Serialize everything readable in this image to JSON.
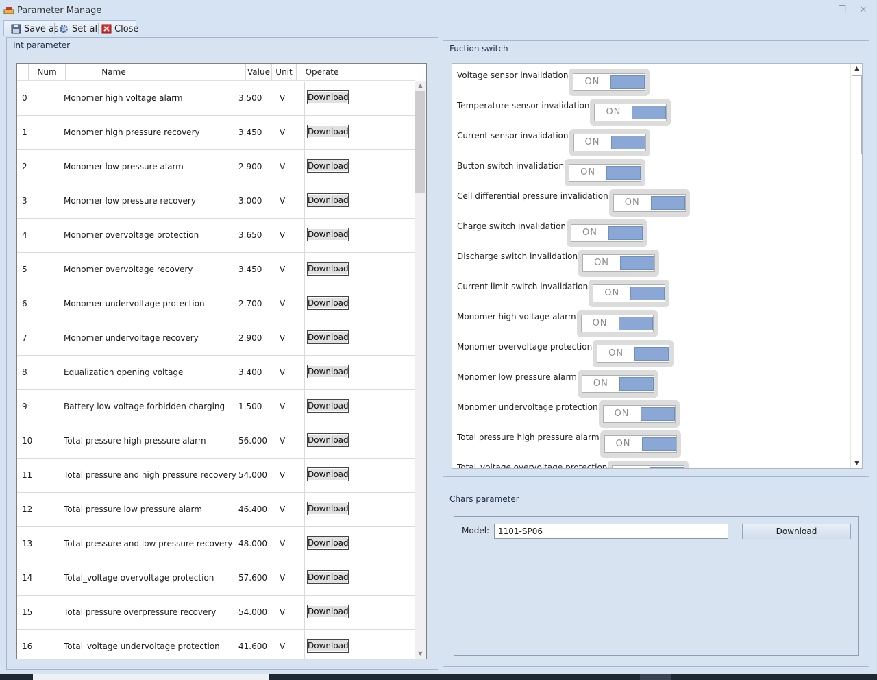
{
  "window": {
    "title": "Parameter Manage"
  },
  "toolbar": {
    "save_as": "Save as",
    "set_all": "Set all",
    "close": "Close"
  },
  "int_panel": {
    "title": "Int parameter",
    "headers": {
      "num": "Num",
      "name": "Name",
      "value": "Value",
      "unit": "Unit",
      "operate": "Operate"
    },
    "rows": [
      {
        "num": "0",
        "name": "Monomer high voltage alarm",
        "value": "3.500",
        "unit": "V",
        "action": "Download"
      },
      {
        "num": "1",
        "name": "Monomer high pressure recovery",
        "value": "3.450",
        "unit": "V",
        "action": "Download"
      },
      {
        "num": "2",
        "name": "Monomer low pressure alarm",
        "value": "2.900",
        "unit": "V",
        "action": "Download"
      },
      {
        "num": "3",
        "name": "Monomer low pressure recovery",
        "value": "3.000",
        "unit": "V",
        "action": "Download"
      },
      {
        "num": "4",
        "name": "Monomer overvoltage protection",
        "value": "3.650",
        "unit": "V",
        "action": "Download"
      },
      {
        "num": "5",
        "name": "Monomer overvoltage recovery",
        "value": "3.450",
        "unit": "V",
        "action": "Download"
      },
      {
        "num": "6",
        "name": "Monomer undervoltage protection",
        "value": "2.700",
        "unit": "V",
        "action": "Download"
      },
      {
        "num": "7",
        "name": "Monomer undervoltage recovery",
        "value": "2.900",
        "unit": "V",
        "action": "Download"
      },
      {
        "num": "8",
        "name": "Equalization opening voltage",
        "value": "3.400",
        "unit": "V",
        "action": "Download"
      },
      {
        "num": "9",
        "name": "Battery low voltage forbidden charging",
        "value": "1.500",
        "unit": "V",
        "action": "Download"
      },
      {
        "num": "10",
        "name": "Total pressure high pressure alarm",
        "value": "56.000",
        "unit": "V",
        "action": "Download"
      },
      {
        "num": "11",
        "name": "Total pressure and high pressure recovery",
        "value": "54.000",
        "unit": "V",
        "action": "Download"
      },
      {
        "num": "12",
        "name": "Total pressure low pressure alarm",
        "value": "46.400",
        "unit": "V",
        "action": "Download"
      },
      {
        "num": "13",
        "name": "Total pressure and low pressure recovery",
        "value": "48.000",
        "unit": "V",
        "action": "Download"
      },
      {
        "num": "14",
        "name": "Total_voltage overvoltage protection",
        "value": "57.600",
        "unit": "V",
        "action": "Download"
      },
      {
        "num": "15",
        "name": "Total pressure overpressure recovery",
        "value": "54.000",
        "unit": "V",
        "action": "Download"
      },
      {
        "num": "16",
        "name": "Total_voltage undervoltage protection",
        "value": "41.600",
        "unit": "V",
        "action": "Download"
      }
    ]
  },
  "switch_panel": {
    "title": "Fuction switch",
    "items": [
      {
        "label": "Voltage sensor invalidation",
        "state": "ON"
      },
      {
        "label": "Temperature sensor invalidation",
        "state": "ON"
      },
      {
        "label": "Current sensor invalidation",
        "state": "ON"
      },
      {
        "label": "Button switch invalidation",
        "state": "ON"
      },
      {
        "label": "Cell differential pressure invalidation",
        "state": "ON"
      },
      {
        "label": "Charge switch invalidation",
        "state": "ON"
      },
      {
        "label": "Discharge switch invalidation",
        "state": "ON"
      },
      {
        "label": "Current limit switch invalidation",
        "state": "ON"
      },
      {
        "label": "Monomer high voltage alarm",
        "state": "ON"
      },
      {
        "label": "Monomer overvoltage protection",
        "state": "ON"
      },
      {
        "label": "Monomer low pressure alarm",
        "state": "ON"
      },
      {
        "label": "Monomer undervoltage protection",
        "state": "ON"
      },
      {
        "label": "Total pressure high pressure alarm",
        "state": "ON"
      },
      {
        "label": "Total_voltage overvoltage protection",
        "state": "ON"
      }
    ]
  },
  "chars_panel": {
    "title": "Chars parameter",
    "model_label": "Model:",
    "model_value": "1101-SP06",
    "download": "Download"
  }
}
